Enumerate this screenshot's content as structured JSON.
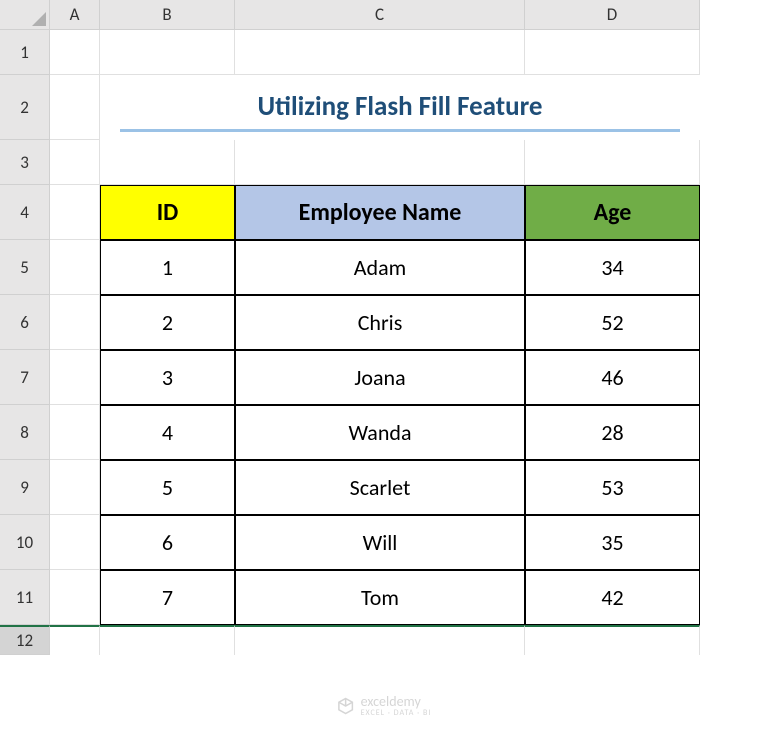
{
  "columns": [
    "A",
    "B",
    "C",
    "D"
  ],
  "rows": [
    "1",
    "2",
    "3",
    "4",
    "5",
    "6",
    "7",
    "8",
    "9",
    "10",
    "11",
    "12"
  ],
  "title": "Utilizing Flash Fill Feature",
  "headers": {
    "id": "ID",
    "name": "Employee Name",
    "age": "Age"
  },
  "chart_data": {
    "type": "table",
    "title": "Utilizing Flash Fill Feature",
    "columns": [
      "ID",
      "Employee Name",
      "Age"
    ],
    "rows": [
      {
        "id": "1",
        "name": "Adam",
        "age": "34"
      },
      {
        "id": "2",
        "name": "Chris",
        "age": "52"
      },
      {
        "id": "3",
        "name": "Joana",
        "age": "46"
      },
      {
        "id": "4",
        "name": "Wanda",
        "age": "28"
      },
      {
        "id": "5",
        "name": "Scarlet",
        "age": "53"
      },
      {
        "id": "6",
        "name": "Will",
        "age": "35"
      },
      {
        "id": "7",
        "name": "Tom",
        "age": "42"
      }
    ]
  },
  "watermark": {
    "brand": "exceldemy",
    "tagline": "EXCEL · DATA · BI"
  }
}
